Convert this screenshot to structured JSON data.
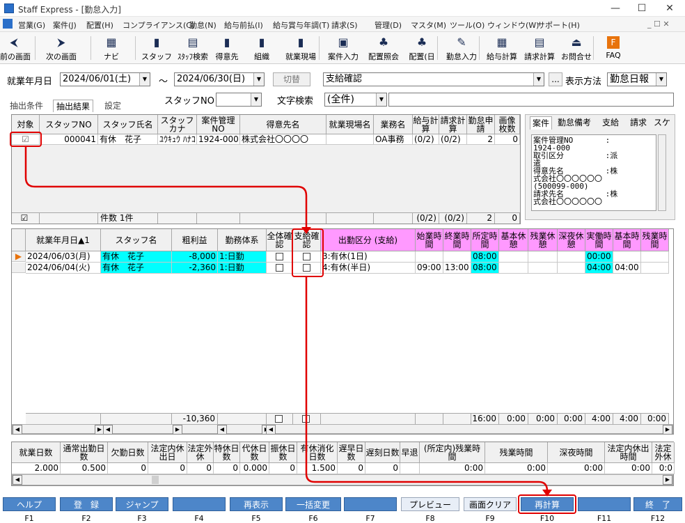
{
  "window": {
    "title": "Staff Express - [勤怠入力]",
    "minimize": "—",
    "maximize": "☐",
    "close": "✕"
  },
  "menu": [
    "営業(G)",
    "案件(J)",
    "配置(H)",
    "コンプライアンス(C)",
    "勤怠(N)",
    "給与前払(I)",
    "給与賞与年調(T)",
    "請求(S)",
    "管理(D)",
    "マスタ(M)",
    "ツール(O)",
    "ウィンドウ(W)",
    "サポート(H)"
  ],
  "menu_right": "_ ☐ ✕",
  "toolbar": [
    {
      "label": "前の画面",
      "icon": "back-arrow-icon"
    },
    {
      "label": "次の画面",
      "icon": "forward-arrow-icon"
    },
    {
      "label": "ナビ",
      "icon": "navigation-icon"
    },
    {
      "label": "スタッフ",
      "icon": "staff-icon"
    },
    {
      "label": "ｽﾀｯﾌ検索",
      "icon": "staff-search-icon"
    },
    {
      "label": "得意先",
      "icon": "customer-icon"
    },
    {
      "label": "組織",
      "icon": "organization-icon"
    },
    {
      "label": "就業現場",
      "icon": "worksite-icon"
    },
    {
      "label": "案件入力",
      "icon": "case-input-icon"
    },
    {
      "label": "配置照会",
      "icon": "assignment-inquiry-icon"
    },
    {
      "label": "配置(日",
      "icon": "assignment-daily-icon"
    },
    {
      "label": "勤怠入力",
      "icon": "attendance-input-icon"
    },
    {
      "label": "給与計算",
      "icon": "salary-calc-icon"
    },
    {
      "label": "請求計算",
      "icon": "billing-calc-icon"
    },
    {
      "label": "お問合せ",
      "icon": "inquiry-icon"
    },
    {
      "label": "FAQ",
      "icon": "faq-icon"
    }
  ],
  "filter": {
    "period_label": "就業年月日",
    "date_from": "2024/06/01(土)",
    "tilde": "～",
    "date_to": "2024/06/30(日)",
    "switch_button": "切替",
    "mode_value": "支給確認",
    "ellipsis": "...",
    "display_label": "表示方法",
    "display_value": "勤怠日報",
    "staffno_label": "スタッフNO",
    "search_label": "文字検索",
    "search_value": "(全件)"
  },
  "tabs": [
    "抽出条件",
    "抽出結果",
    "設定"
  ],
  "upper_grid": {
    "headers": [
      "対象",
      "スタッフNO",
      "スタッフ氏名",
      "スタッフカナ",
      "案件管理NO",
      "得意先名",
      "就業現場名",
      "業務名",
      "給与計算",
      "請求計算",
      "勤怠申請",
      "画像枚数"
    ],
    "row": [
      "☑",
      "000041",
      "有休　花子",
      "ﾕｳｷｭｳ ﾊﾅｺ",
      "1924-000",
      "株式会社〇〇〇〇",
      "",
      "OA事務",
      "(0/2)",
      "(0/2)",
      "2",
      "0"
    ],
    "footer": {
      "check": "☑",
      "count": "件数 1件",
      "salary": "(0/2)",
      "billing": "(0/2)",
      "apply": "2",
      "images": "0"
    }
  },
  "right_panel": {
    "tabs": [
      "案件",
      "勤怠備考",
      "支給",
      "請求",
      "スケ"
    ],
    "text": "案件管理NO       :\n1924-000\n取引区分         :派\n遣\n得意先名         :株\n式会社〇〇〇〇〇〇\n(500099-000)\n請求先名         :株\n式会社〇〇〇〇〇〇"
  },
  "lower_grid": {
    "headers": [
      "就業年月日▲1",
      "スタッフ名",
      "粗利益",
      "勤務体系",
      "全体確認",
      "支給確認",
      "出勤区分 (支給)",
      "始業時間",
      "終業時間",
      "所定時間",
      "基本休憩",
      "残業休憩",
      "深夜休憩",
      "実働時間",
      "基本時間",
      "残業時間"
    ],
    "rows": [
      {
        "date": "2024/06/03(月)",
        "name": "有休　花子",
        "profit": "-8,000",
        "system": "1:日勤",
        "kubun": "3:有休(1日)",
        "start": "",
        "end": "",
        "shotei": "08:00",
        "base_rest": "",
        "over_rest": "",
        "night_rest": "",
        "actual": "00:00",
        "base_time": "",
        "over_time": ""
      },
      {
        "date": "2024/06/04(火)",
        "name": "有休　花子",
        "profit": "-2,360",
        "system": "1:日勤",
        "kubun": "4:有休(半日)",
        "start": "09:00",
        "end": "13:00",
        "shotei": "08:00",
        "base_rest": "",
        "over_rest": "",
        "night_rest": "",
        "actual": "04:00",
        "base_time": "04:00",
        "over_time": ""
      }
    ],
    "footer": {
      "profit": "-10,360",
      "shotei": "16:00",
      "base_rest": "0:00",
      "over_rest": "0:00",
      "night_rest": "0:00",
      "actual": "4:00",
      "base_time": "4:00",
      "over_time": "0:00"
    }
  },
  "summary": {
    "headers": [
      "就業日数",
      "通常出勤日数",
      "欠勤日数",
      "法定内休出日",
      "法定外休",
      "特休日数",
      "代休日数",
      "振休日数",
      "有休消化日数",
      "遅早日数",
      "遅刻日数",
      "早退",
      "(所定内)残業時間",
      "残業時間",
      "深夜時間",
      "法定内休出時間",
      "法定外休"
    ],
    "values": [
      "2.000",
      "0.500",
      "0",
      "0",
      "0",
      "0",
      "0.000",
      "0",
      "1.500",
      "0",
      "0",
      "",
      "0:00",
      "0:00",
      "0:00",
      "0:00",
      "0:0"
    ]
  },
  "fkeys": [
    {
      "label": "ヘルプ",
      "key": "F1"
    },
    {
      "label": "登　録",
      "key": "F2"
    },
    {
      "label": "ジャンプ",
      "key": "F3"
    },
    {
      "label": "",
      "key": "F4"
    },
    {
      "label": "再表示",
      "key": "F5"
    },
    {
      "label": "一括変更",
      "key": "F6"
    },
    {
      "label": "",
      "key": "F7"
    },
    {
      "label": "プレビュー",
      "key": "F8"
    },
    {
      "label": "画面クリア",
      "key": "F9"
    },
    {
      "label": "再計算",
      "key": "F10"
    },
    {
      "label": "",
      "key": "F11"
    },
    {
      "label": "終　了",
      "key": "F12"
    }
  ],
  "colors": {
    "annotation": "#e00000",
    "fkey": "#4d86c9",
    "pink_header": "#ff99ff",
    "cyan": "#00ffff"
  }
}
